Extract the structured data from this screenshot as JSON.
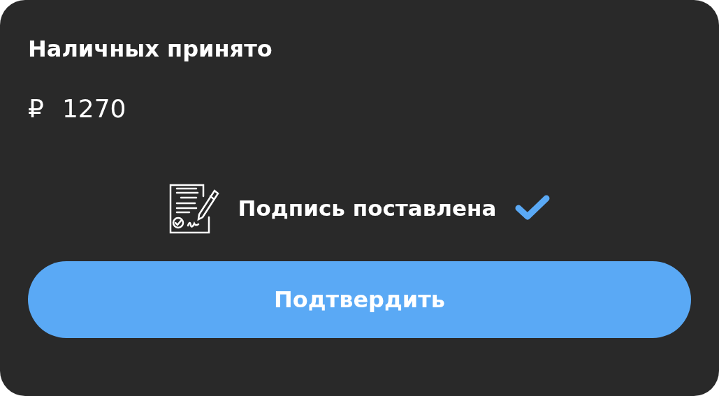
{
  "title": "Наличных принято",
  "amount": {
    "currency": "₽",
    "value": "1270"
  },
  "signature": {
    "label": "Подпись поставлена",
    "signed": true
  },
  "button": {
    "label": "Подтвердить"
  }
}
